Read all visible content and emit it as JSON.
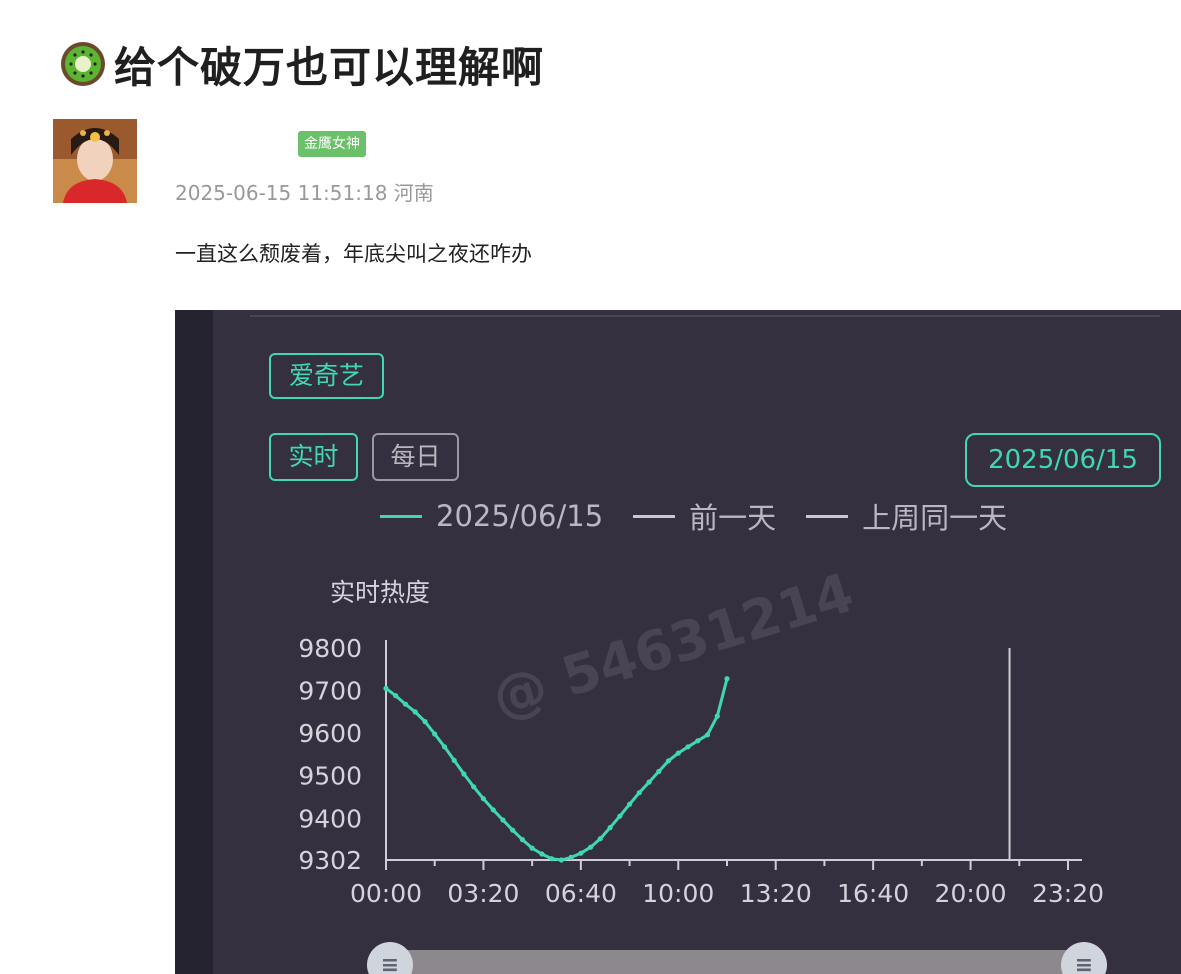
{
  "post": {
    "title": "给个破万也可以理解啊",
    "title_icon": "kiwi-emoji",
    "user_badge": "金鹰女神",
    "timestamp": "2025-06-15 11:51:18",
    "location": "河南",
    "text": "一直这么颓废着，年底尖叫之夜还咋办"
  },
  "screenshot": {
    "platform_button": "爱奇艺",
    "tabs": {
      "realtime": "实时",
      "daily": "每日"
    },
    "date_button": "2025/06/15",
    "watermark": "@ 54631214",
    "legend": [
      {
        "label": "2025/06/15",
        "color": "#3fd8b2"
      },
      {
        "label": "前一天",
        "color": "#c9c7d0"
      },
      {
        "label": "上周同一天",
        "color": "#c9c7d0"
      }
    ],
    "accent_color": "#3fd8b2",
    "background_color": "#34303f"
  },
  "chart_data": {
    "type": "line",
    "ylabel": "实时热度",
    "y_ticks": [
      9302,
      9400,
      9500,
      9600,
      9700,
      9800
    ],
    "ylim": [
      9302,
      9800
    ],
    "x_ticks": [
      "00:00",
      "03:20",
      "06:40",
      "10:00",
      "13:20",
      "16:40",
      "20:00",
      "23:20"
    ],
    "x_range_minutes": [
      0,
      1400
    ],
    "marker_line_x": "21:20",
    "series": [
      {
        "name": "2025/06/15",
        "x": [
          "00:00",
          "00:20",
          "00:40",
          "01:00",
          "01:20",
          "01:40",
          "02:00",
          "02:20",
          "02:40",
          "03:00",
          "03:20",
          "03:40",
          "04:00",
          "04:20",
          "04:40",
          "05:00",
          "05:20",
          "05:40",
          "06:00",
          "06:20",
          "06:40",
          "07:00",
          "07:20",
          "07:40",
          "08:00",
          "08:20",
          "08:40",
          "09:00",
          "09:20",
          "09:40",
          "10:00",
          "10:20",
          "10:40",
          "11:00",
          "11:20",
          "11:40"
        ],
        "values": [
          9705,
          9688,
          9668,
          9650,
          9627,
          9598,
          9568,
          9536,
          9504,
          9474,
          9446,
          9420,
          9396,
          9372,
          9350,
          9330,
          9316,
          9305,
          9302,
          9308,
          9318,
          9332,
          9352,
          9378,
          9405,
          9433,
          9460,
          9485,
          9510,
          9535,
          9553,
          9568,
          9582,
          9596,
          9640,
          9728
        ]
      }
    ]
  }
}
